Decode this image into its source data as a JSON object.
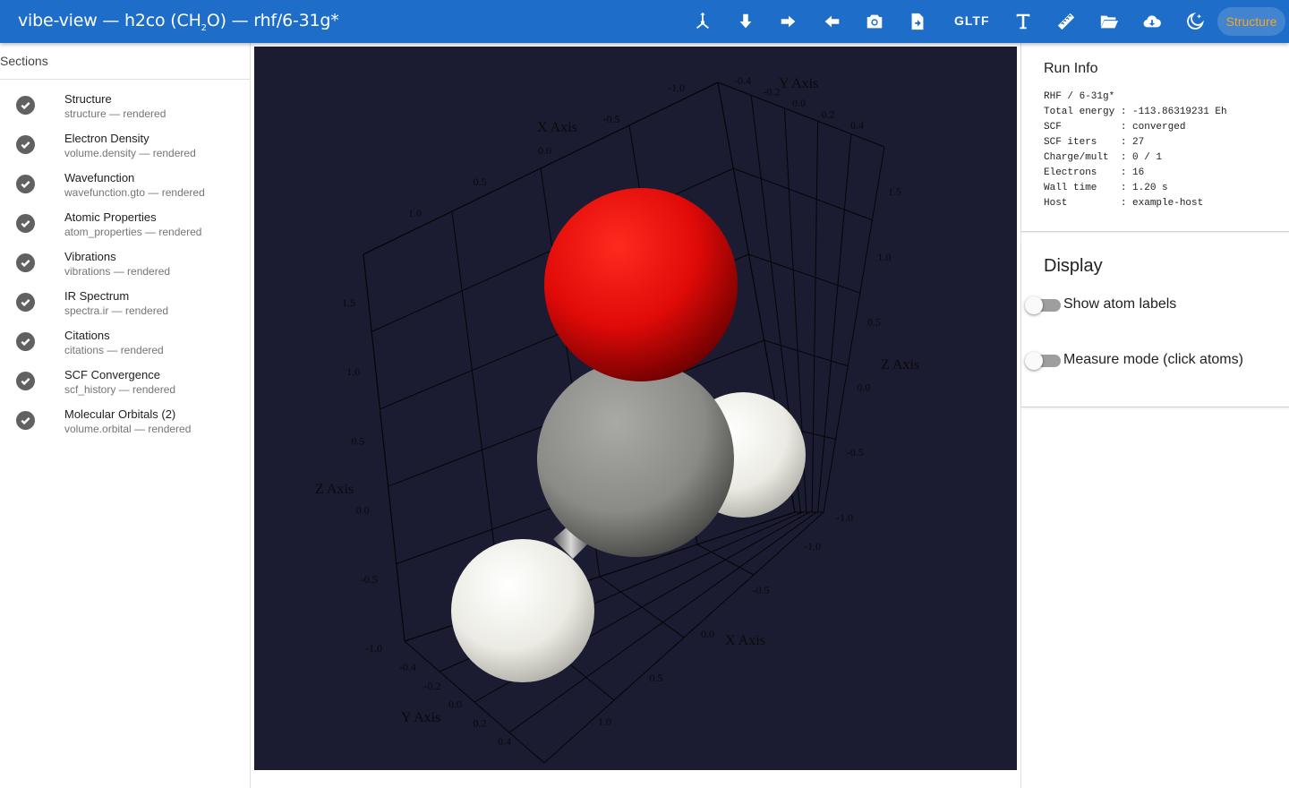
{
  "app": {
    "title_prefix": "vibe-view — h2co (CH",
    "title_sub": "2",
    "title_suffix": "O) — rhf/6-31g*"
  },
  "toolbar": {
    "icons": [
      "axes-icon",
      "arrow-down-icon",
      "arrow-right-icon",
      "arrow-left-icon",
      "camera-icon",
      "export-file-icon",
      "gltf-export",
      "text-icon",
      "ruler-icon",
      "folder-open-icon",
      "cloud-download-icon",
      "theme-toggle-icon"
    ],
    "gltf_label": "GLTF",
    "chip_label": "Structure",
    "chip_color": "#f5a623",
    "bar_color": "#1e6dc8"
  },
  "sidebar": {
    "heading": "Sections",
    "items": [
      {
        "title": "Structure",
        "subtitle": "structure — rendered"
      },
      {
        "title": "Electron Density",
        "subtitle": "volume.density — rendered"
      },
      {
        "title": "Wavefunction",
        "subtitle": "wavefunction.gto — rendered"
      },
      {
        "title": "Atomic Properties",
        "subtitle": "atom_properties — rendered"
      },
      {
        "title": "Vibrations",
        "subtitle": "vibrations — rendered"
      },
      {
        "title": "IR Spectrum",
        "subtitle": "spectra.ir — rendered"
      },
      {
        "title": "Citations",
        "subtitle": "citations — rendered"
      },
      {
        "title": "SCF Convergence",
        "subtitle": "scf_history — rendered"
      },
      {
        "title": "Molecular Orbitals (2)",
        "subtitle": "volume.orbital — rendered"
      }
    ]
  },
  "viewer": {
    "background": "#1b1b32",
    "axis_titles": {
      "x": "X Axis",
      "y": "Y Axis",
      "z": "Z Axis"
    },
    "x_ticks_back": [
      "1.0",
      "0.5",
      "0.0",
      "-0.5",
      "-1.0"
    ],
    "y_ticks_back": [
      "-0.4",
      "-0.2",
      "0.0",
      "0.2",
      "0.4"
    ],
    "z_ticks_left": [
      "1.5",
      "1.0",
      "0.5",
      "0.0",
      "-0.5",
      "-1.0"
    ],
    "z_ticks_right": [
      "1.5",
      "1.0",
      "0.5",
      "0.0",
      "-0.5",
      "-1.0"
    ],
    "x_ticks_front": [
      "-1.0",
      "-0.5",
      "0.0",
      "0.5",
      "1.0"
    ],
    "y_ticks_front": [
      "-0.4",
      "-0.2",
      "0.0",
      "0.2",
      "0.4"
    ],
    "atoms": [
      {
        "element": "O",
        "color": "#e01010"
      },
      {
        "element": "C",
        "color": "#8a8a86"
      },
      {
        "element": "H",
        "color": "#e8e8e0"
      },
      {
        "element": "H",
        "color": "#e8e8e0"
      }
    ]
  },
  "run_info": {
    "title": "Run Info",
    "lines": [
      "RHF / 6-31g*",
      "Total energy : -113.86319231 Eh",
      "SCF          : converged",
      "SCF iters    : 27",
      "Charge/mult  : 0 / 1",
      "Electrons    : 16",
      "Wall time    : 1.20 s",
      "Host         : example-host"
    ]
  },
  "display": {
    "title": "Display",
    "toggles": [
      {
        "label": "Show atom labels",
        "on": false
      },
      {
        "label": "Measure mode (click atoms)",
        "on": false
      }
    ]
  }
}
